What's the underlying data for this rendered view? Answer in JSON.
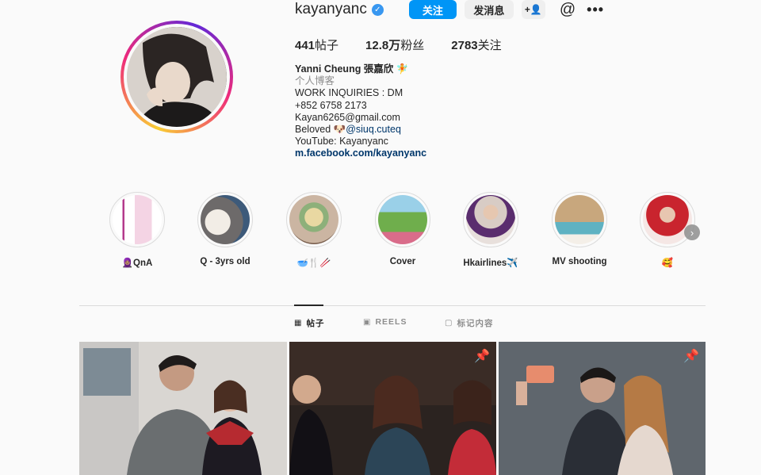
{
  "profile": {
    "username": "kayanyanc",
    "verified_icon": "verified-badge-icon",
    "follow_label": "关注",
    "message_label": "发消息",
    "add_user_icon": "add-user-icon",
    "threads_icon": "threads-icon",
    "more_icon": "more-options-icon"
  },
  "stats": {
    "posts": "441",
    "posts_label": "帖子",
    "followers": "12.8万",
    "followers_label": "粉丝",
    "following": "2783",
    "following_label": "关注"
  },
  "bio": {
    "name": "Yanni Cheung 張嘉欣 🧚",
    "category": "个人博客",
    "line1": "WORK INQUIRIES : DM",
    "line2": "+852 6758 2173",
    "line3": "Kayan6265@gmail.com",
    "line4_prefix": "Beloved 🐶",
    "line4_mention": "@siuq.cuteq",
    "line5": "YouTube: Kayanyanc",
    "link": "m.facebook.com/kayanyanc"
  },
  "highlights": [
    {
      "label": "🧕🏽QnA"
    },
    {
      "label": "Q - 3yrs old"
    },
    {
      "label": "🥣🍴🥢"
    },
    {
      "label": "Cover"
    },
    {
      "label": "Hkairlines✈️"
    },
    {
      "label": "MV shooting"
    },
    {
      "label": "🥰"
    }
  ],
  "tabs": [
    {
      "label": "帖子",
      "icon": "grid-icon",
      "active": true
    },
    {
      "label": "REELS",
      "icon": "reels-icon",
      "active": false
    },
    {
      "label": "标记内容",
      "icon": "tagged-icon",
      "active": false
    }
  ],
  "posts": [
    {
      "pinned": false
    },
    {
      "pinned": true
    },
    {
      "pinned": true
    }
  ],
  "colors": {
    "follow_button": "#0095f6",
    "link": "#00376b",
    "verified": "#3897f0"
  }
}
